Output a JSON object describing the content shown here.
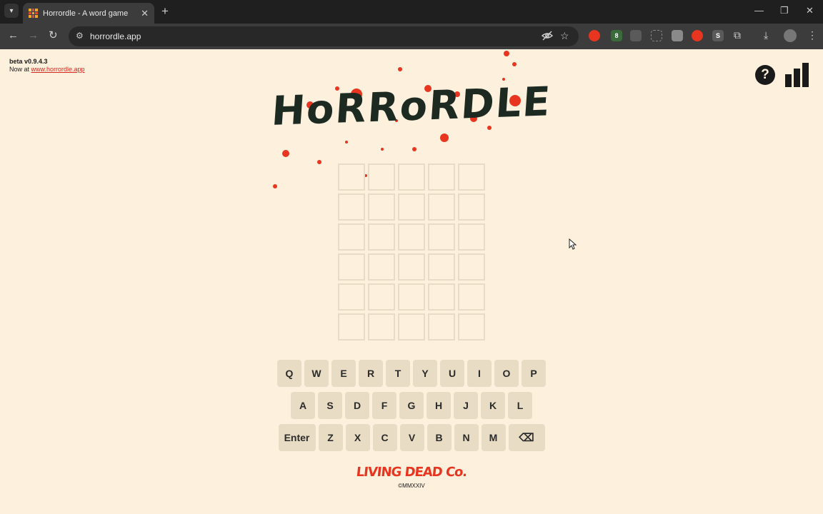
{
  "browser": {
    "tab_title": "Horrordle - A word game",
    "url": "horrordle.app",
    "icons": {
      "tab_search": "chevron-down-icon",
      "close_tab": "close-icon",
      "new_tab": "plus-icon",
      "back": "arrow-left-icon",
      "forward": "arrow-right-icon",
      "reload": "reload-icon",
      "site_info": "tune-icon",
      "eye_off": "eye-off-icon",
      "bookmark": "star-icon",
      "downloads": "download-icon",
      "menu": "more-vert-icon"
    },
    "extension_badge": "8",
    "extension_letter": "S"
  },
  "page": {
    "version": "beta v0.9.4.3",
    "now_at_prefix": "Now at ",
    "now_at_link": "www.horrordle.app",
    "logo_text": "HoRRoRDLE",
    "help_label": "?",
    "grid": {
      "rows": 6,
      "cols": 5
    },
    "keyboard": {
      "row1": [
        "Q",
        "W",
        "E",
        "R",
        "T",
        "Y",
        "U",
        "I",
        "O",
        "P"
      ],
      "row2": [
        "A",
        "S",
        "D",
        "F",
        "G",
        "H",
        "J",
        "K",
        "L"
      ],
      "row3": [
        "Enter",
        "Z",
        "X",
        "C",
        "V",
        "B",
        "N",
        "M",
        "⌫"
      ]
    },
    "brand": "LIVING DEAD Co.",
    "copyright": "©MMXXIV"
  },
  "colors": {
    "page_bg": "#fdf0dc",
    "key_bg": "#e9dcc4",
    "blood_red": "#e8351f",
    "ink": "#1d2a22"
  }
}
